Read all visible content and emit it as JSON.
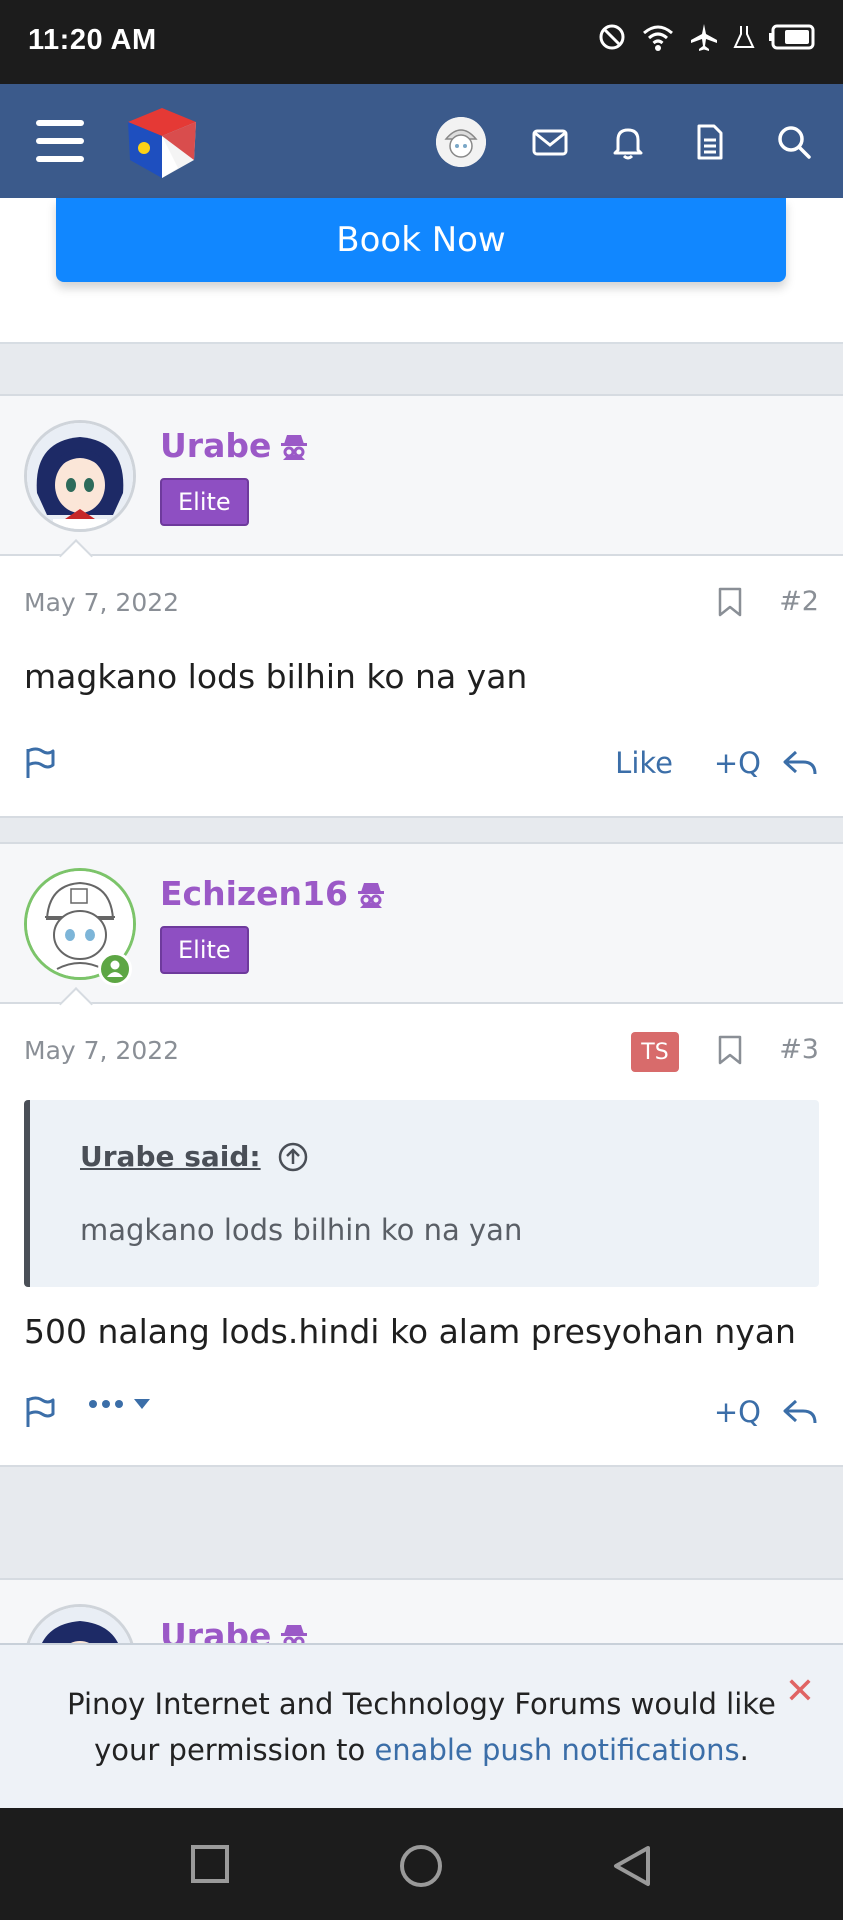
{
  "status_bar": {
    "time": "11:20 AM"
  },
  "header": {
    "icons": [
      "menu-icon",
      "site-logo",
      "user-avatar",
      "envelope-icon",
      "bell-icon",
      "document-icon",
      "search-icon"
    ]
  },
  "ad": {
    "button_label": "Book Now"
  },
  "posts": [
    {
      "username": "Urabe",
      "rank": "Elite",
      "date": "May 7, 2022",
      "number": "#2",
      "body": "magkano lods bilhin ko na yan",
      "actions": {
        "like": "Like",
        "quote": "+Q"
      }
    },
    {
      "username": "Echizen16",
      "rank": "Elite",
      "date": "May 7, 2022",
      "badge": "TS",
      "number": "#3",
      "quote": {
        "author": "Urabe said:",
        "text": "magkano lods bilhin ko na yan"
      },
      "body": "500 nalang lods.hindi ko alam presyohan nyan",
      "actions": {
        "quote": "+Q"
      }
    },
    {
      "username": "Urabe"
    }
  ],
  "banner": {
    "text_before": "Pinoy Internet and Technology Forums would like your permission to ",
    "link": "enable push notifications",
    "text_after": ".",
    "close": "✕"
  },
  "colors": {
    "header": "#3b5a8b",
    "button": "#1187ff",
    "username": "#9b59c7",
    "rank": "#8e4fc2",
    "link": "#3b6ea8"
  }
}
